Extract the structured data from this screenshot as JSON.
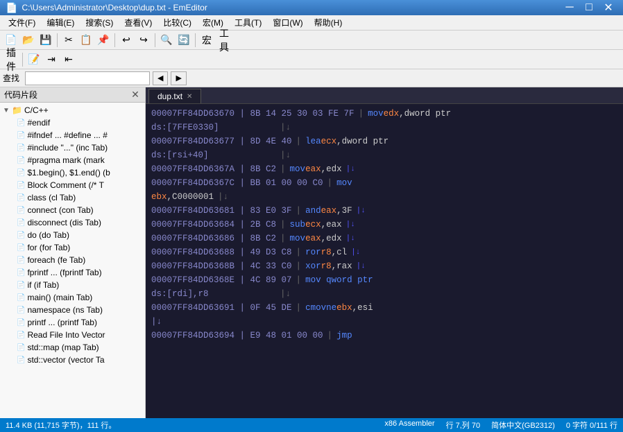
{
  "titlebar": {
    "icon": "📄",
    "title": "C:\\Users\\Administrator\\Desktop\\dup.txt - EmEditor",
    "minimize": "─",
    "maximize": "□",
    "close": "✕"
  },
  "menubar": {
    "items": [
      "文件(F)",
      "编辑(E)",
      "搜索(S)",
      "查看(V)",
      "比较(C)",
      "宏(M)",
      "工具(T)",
      "窗口(W)",
      "帮助(H)"
    ]
  },
  "search": {
    "label": "查找",
    "placeholder": ""
  },
  "leftpanel": {
    "title": "代码片段",
    "root": {
      "label": "C/C++",
      "children": [
        "#endif",
        "#ifndef ... #define ... #",
        "#include \"...\" (inc Tab)",
        "#pragma mark (mark",
        "$1.begin(), $1.end() (b",
        "Block Comment (/* T",
        "class  (cl Tab)",
        "connect  (con Tab)",
        "disconnect  (dis Tab)",
        "do  (do Tab)",
        "for  (for Tab)",
        "foreach  (fe Tab)",
        "fprintf ...  (fprintf Tab)",
        "if  (if Tab)",
        "main()  (main Tab)",
        "namespace  (ns Tab)",
        "printf ...  (printf Tab)",
        "Read File Into Vector",
        "std::map  (map Tab)",
        "std::vector  (vector Ta"
      ]
    }
  },
  "editor": {
    "tab": "dup.txt",
    "lines": [
      {
        "addr": "00007FF84DD63670 | 8B 14 25 30 03 FE 7F",
        "spacer": "           ",
        "pipe": "|",
        "code": "mov edx,dword ptr",
        "arrow": false
      },
      {
        "addr": "ds:[7FFE0330]",
        "spacer": "    ",
        "pipe": "|↓",
        "code": "",
        "arrow": false
      },
      {
        "addr": "00007FF84DD63677 | 8D 4E 40",
        "spacer": "               ",
        "pipe": "|",
        "code": "lea ecx,dword ptr",
        "arrow": false
      },
      {
        "addr": "ds:[rsi+40]",
        "spacer": "       ",
        "pipe": "|↓",
        "code": "",
        "arrow": false
      },
      {
        "addr": "00007FF84DD6367A | 8B C2",
        "spacer": "                  ",
        "pipe": "|",
        "code": "mov eax,edx",
        "arrow": true
      },
      {
        "addr": "00007FF84DD6367C | BB 01 00 00 C0",
        "spacer": "            ",
        "pipe": "|",
        "code": "mov",
        "arrow": false
      },
      {
        "addr": "ebx,C0000001",
        "spacer": "             ",
        "pipe": "|↓",
        "code": "",
        "arrow": false
      },
      {
        "addr": "00007FF84DD63681 | 83 E0 3F",
        "spacer": "               ",
        "pipe": "|",
        "code": "and eax,3F",
        "arrow": true
      },
      {
        "addr": "00007FF84DD63684 | 2B C8",
        "spacer": "                  ",
        "pipe": "|",
        "code": "sub ecx,eax",
        "arrow": true
      },
      {
        "addr": "00007FF84DD63686 | 8B C2",
        "spacer": "                  ",
        "pipe": "|",
        "code": "mov eax,edx",
        "arrow": true
      },
      {
        "addr": "00007FF84DD63688 | 49 D3 C8",
        "spacer": "               ",
        "pipe": "|",
        "code": "ror r8,cl",
        "arrow": true
      },
      {
        "addr": "00007FF84DD6368B | 4C 33 C0",
        "spacer": "               ",
        "pipe": "|",
        "code": "xor r8,rax",
        "arrow": true
      },
      {
        "addr": "00007FF84DD6368E | 4C 89 07",
        "spacer": "               ",
        "pipe": "|",
        "code": "mov qword ptr",
        "arrow": false
      },
      {
        "addr": "ds:[rdi],r8",
        "spacer": "       ",
        "pipe": "|↓",
        "code": "",
        "arrow": false
      },
      {
        "addr": "00007FF84DD63691 | 0F 45 DE",
        "spacer": "               ",
        "pipe": "|",
        "code": "cmovne ebx,esi",
        "arrow": false
      },
      {
        "addr": "           |↓",
        "spacer": "",
        "pipe": "",
        "code": "",
        "arrow": false
      },
      {
        "addr": "00007FF84DD63694 | E9 48 01 00 00",
        "spacer": "            ",
        "pipe": "|",
        "code": "jmp",
        "arrow": false
      }
    ]
  },
  "statusbar": {
    "filesize": "11.4 KB (11,715 字节)，111 行。",
    "mode": "x86 Assembler",
    "position": "行 7,列 70",
    "encoding": "简体中文(GB2312)",
    "selection": "0 字符 0/111 行"
  }
}
